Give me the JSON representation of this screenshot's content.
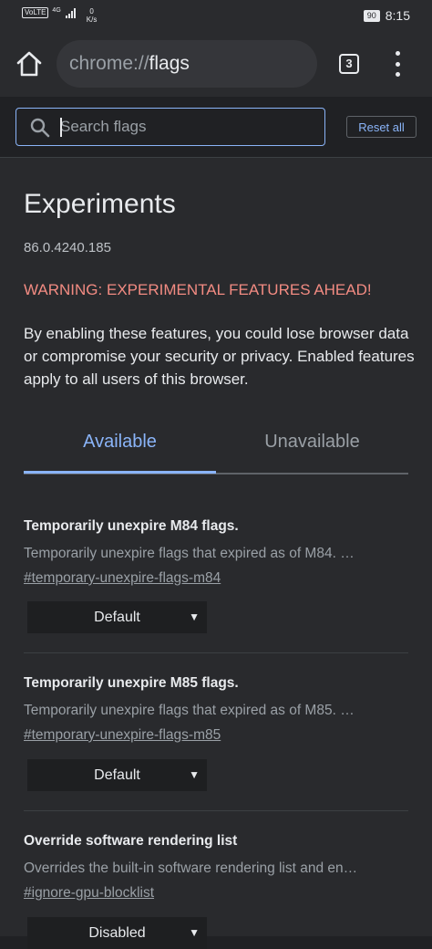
{
  "status_bar": {
    "network_badge": "VoLTE",
    "signal_label": "4G",
    "speed_value": "0",
    "speed_unit": "K/s",
    "battery": "90",
    "time": "8:15"
  },
  "toolbar": {
    "url_scheme": "chrome://",
    "url_host": "flags",
    "tab_count": "3"
  },
  "search": {
    "placeholder": "Search flags",
    "value": "",
    "reset_label": "Reset all"
  },
  "page": {
    "title": "Experiments",
    "version": "86.0.4240.185",
    "warning": "WARNING: EXPERIMENTAL FEATURES AHEAD!",
    "description": "By enabling these features, you could lose browser data or compromise your security or privacy. Enabled features apply to all users of this browser."
  },
  "tabs": [
    {
      "label": "Available",
      "active": true
    },
    {
      "label": "Unavailable",
      "active": false
    }
  ],
  "flags": [
    {
      "title": "Temporarily unexpire M84 flags.",
      "description": "Temporarily unexpire flags that expired as of M84. …",
      "link": "#temporary-unexpire-flags-m84",
      "value": "Default"
    },
    {
      "title": "Temporarily unexpire M85 flags.",
      "description": "Temporarily unexpire flags that expired as of M85. …",
      "link": "#temporary-unexpire-flags-m85",
      "value": "Default"
    },
    {
      "title": "Override software rendering list",
      "description": "Overrides the built-in software rendering list and en…",
      "link": "#ignore-gpu-blocklist",
      "value": "Disabled"
    }
  ],
  "colors": {
    "accent": "#8ab4f8",
    "warning": "#f28b82",
    "background": "#292a2d"
  }
}
